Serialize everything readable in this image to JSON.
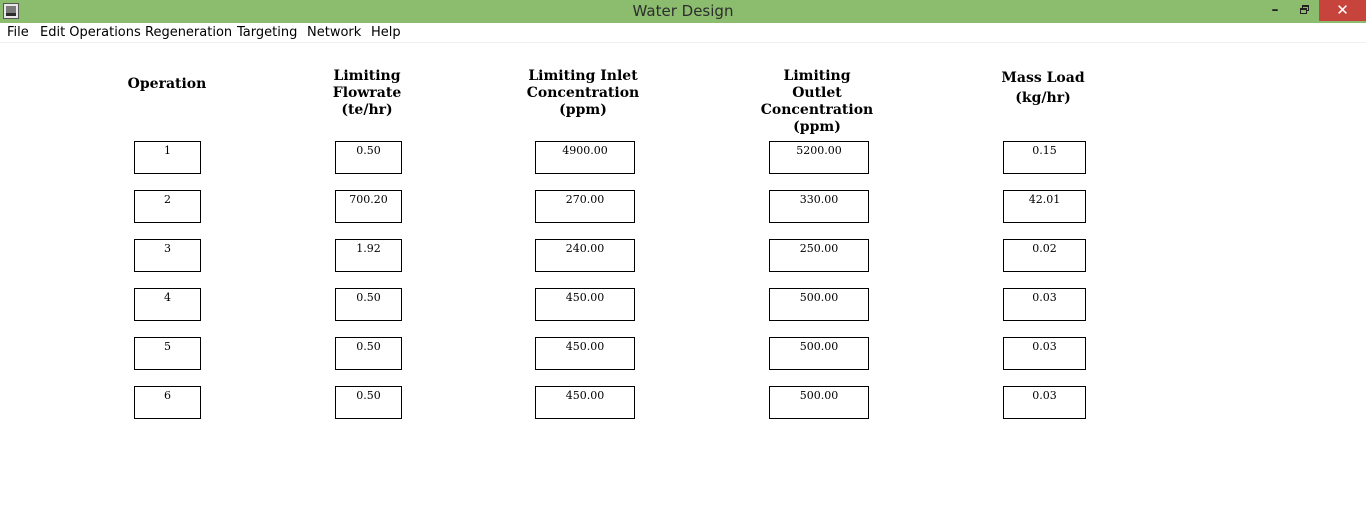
{
  "window": {
    "title": "Water Design",
    "minimize_glyph": "–",
    "close_glyph": "✕",
    "app_icon": "java-app-icon",
    "titlebar_color": "#8cbd6e",
    "close_color": "#c7443c"
  },
  "menu": {
    "items": [
      "File",
      "Edit Operations",
      "Regeneration",
      "Targeting",
      "Network",
      "Help"
    ]
  },
  "table": {
    "headers": [
      [
        "Operation"
      ],
      [
        "Limiting",
        "Flowrate",
        "(te/hr)"
      ],
      [
        "Limiting Inlet",
        "Concentration",
        "(ppm)"
      ],
      [
        "Limiting",
        "Outlet",
        "Concentration",
        "(ppm)"
      ],
      [
        "Mass Load",
        "(kg/hr)"
      ]
    ],
    "rows": [
      [
        "1",
        "0.50",
        "4900.00",
        "5200.00",
        "0.15"
      ],
      [
        "2",
        "700.20",
        "270.00",
        "330.00",
        "42.01"
      ],
      [
        "3",
        "1.92",
        "240.00",
        "250.00",
        "0.02"
      ],
      [
        "4",
        "0.50",
        "450.00",
        "500.00",
        "0.03"
      ],
      [
        "5",
        "0.50",
        "450.00",
        "500.00",
        "0.03"
      ],
      [
        "6",
        "0.50",
        "450.00",
        "500.00",
        "0.03"
      ]
    ]
  }
}
